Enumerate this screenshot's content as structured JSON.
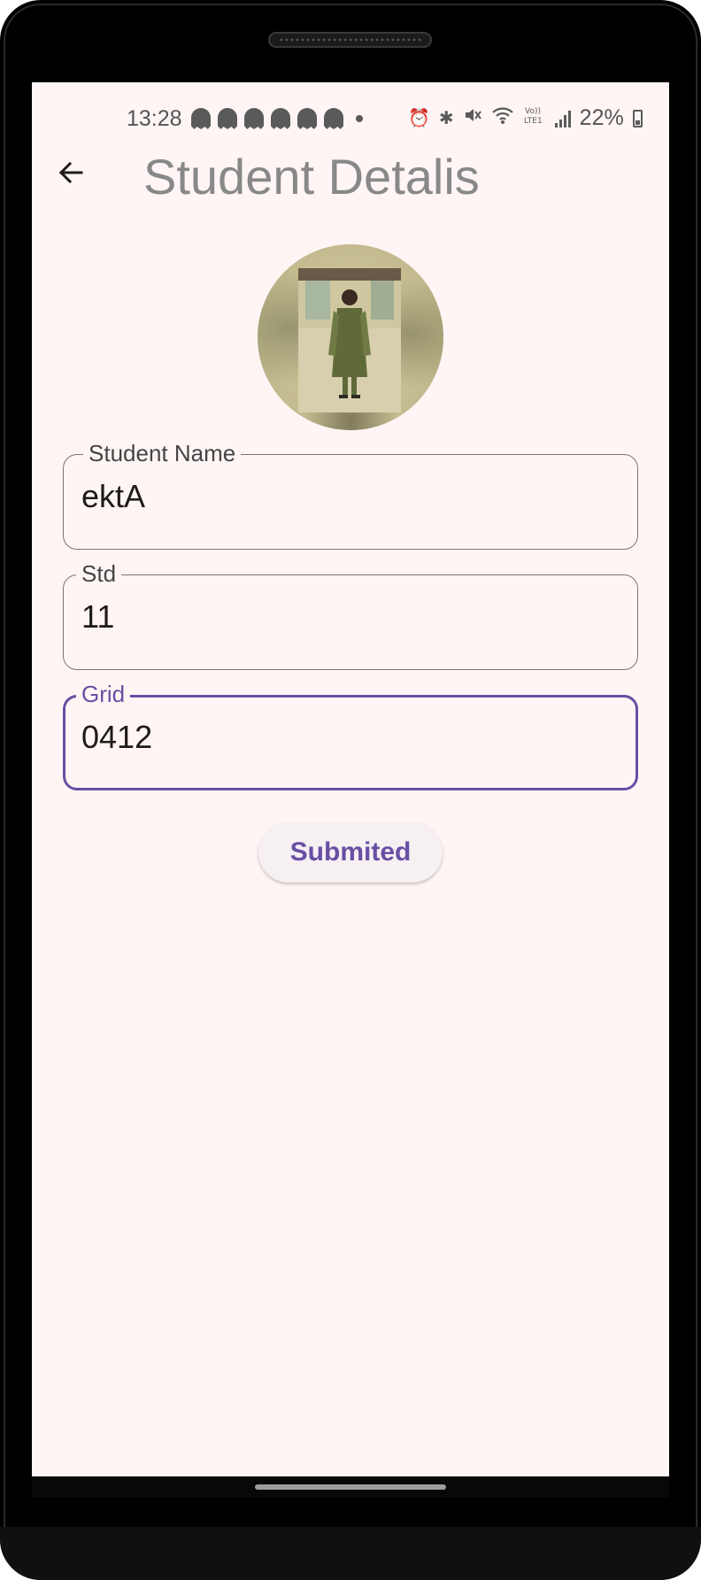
{
  "status_bar": {
    "time": "13:28",
    "battery": "22%",
    "notification_icons": [
      "snapchat-icon",
      "snapchat-icon",
      "snapchat-icon",
      "snapchat-icon",
      "snapchat-icon",
      "snapchat-icon",
      "dot-icon"
    ],
    "system_icons": [
      "alarm-icon",
      "bluetooth-icon",
      "mute-icon",
      "wifi-icon",
      "volte-icon",
      "signal-icon",
      "battery-icon"
    ]
  },
  "app_bar": {
    "title": "Student Detalis",
    "back_icon": "arrow-back-icon"
  },
  "form": {
    "student_name": {
      "label": "Student Name",
      "value": "ektA"
    },
    "std": {
      "label": "Std",
      "value": "11"
    },
    "grid": {
      "label": "Grid",
      "value": "0412"
    },
    "submit_label": "Submited"
  },
  "colors": {
    "primary": "#6750a4",
    "background": "#fff5f5",
    "title": "#888888",
    "outline": "#7a7575"
  }
}
